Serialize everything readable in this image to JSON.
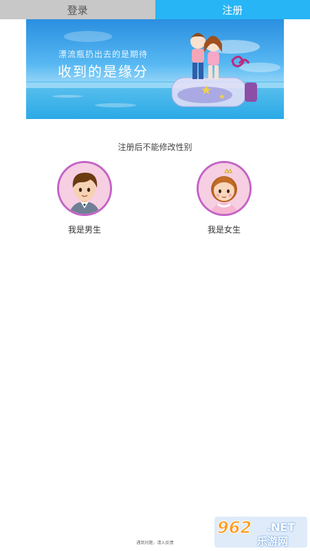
{
  "tabs": {
    "login_label": "登录",
    "register_label": "注册"
  },
  "banner": {
    "line1": "漂流瓶扔出去的是期待",
    "line2": "收到的是缘分"
  },
  "gender": {
    "note": "注册后不能修改性别",
    "male_label": "我是男生",
    "female_label": "我是女生"
  },
  "footer": {
    "feedback": "遇到问题，请入反馈"
  },
  "watermark": {
    "number": "962",
    "net": ".NET",
    "site": "乐游网"
  },
  "colors": {
    "accent": "#27b5f5",
    "inactive_tab": "#c8c8c8",
    "avatar_border": "#c463c6"
  }
}
